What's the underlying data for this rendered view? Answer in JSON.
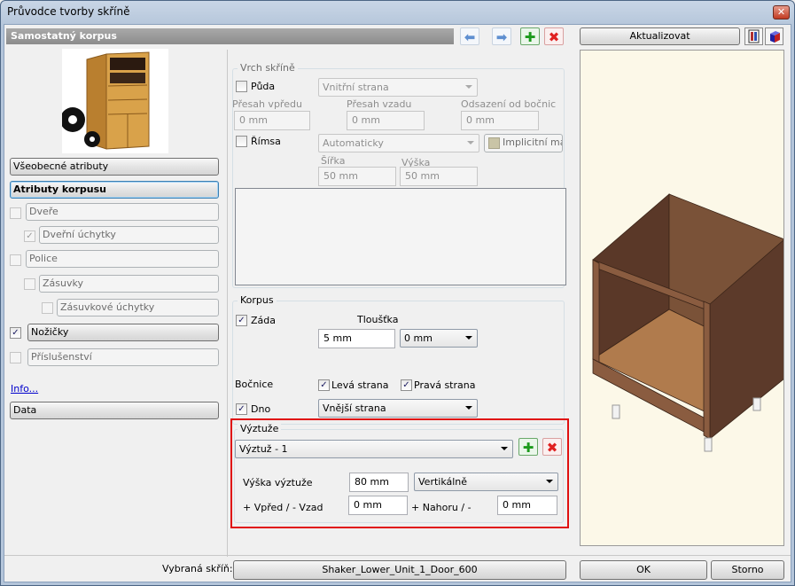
{
  "window": {
    "title": "Průvodce tvorby skříně",
    "close_glyph": "✕"
  },
  "header": {
    "title": "Samostatný korpus"
  },
  "toolbar": {
    "back_glyph": "⬅",
    "forward_glyph": "➡",
    "add_glyph": "✚",
    "remove_glyph": "✖"
  },
  "sidebar": {
    "general": "Všeobecné atributy",
    "carcass": "Atributy korpusu",
    "doors": "Dveře",
    "door_handles": "Dveřní úchytky",
    "shelves": "Police",
    "drawers": "Zásuvky",
    "drawer_handles": "Zásuvkové úchytky",
    "legs": "Nožičky",
    "accessories": "Příslušenství",
    "info_link": "Info...",
    "data": "Data"
  },
  "top": {
    "group_title": "Vrch skříně",
    "bottom_label": "Půda",
    "bottom_combo": "Vnitřní strana",
    "front_overhang_label": "Přesah vpředu",
    "front_overhang": "0 mm",
    "back_overhang_label": "Přesah vzadu",
    "back_overhang": "0 mm",
    "side_offset_label": "Odsazení od bočnic",
    "side_offset": "0 mm",
    "cornice_label": "Římsa",
    "cornice_combo": "Automaticky",
    "material_label": "Implicitní mate",
    "width_label": "Šířka",
    "width": "50 mm",
    "height_label": "Výška",
    "height": "50 mm"
  },
  "carcass": {
    "group_title": "Korpus",
    "back_label": "Záda",
    "thickness_label": "Tloušťka",
    "thickness": "5 mm",
    "thickness_combo": "0 mm",
    "sides_label": "Bočnice",
    "left_side": "Levá strana",
    "right_side": "Pravá strana",
    "bottom_label": "Dno",
    "bottom_combo": "Vnější strana"
  },
  "stiffeners": {
    "group_title": "Výztuže",
    "selected": "Výztuž - 1",
    "height_label": "Výška výztuže",
    "height": "80 mm",
    "orientation": "Vertikálně",
    "front_back_label": "+ Vpřed / - Vzad",
    "front_back": "0 mm",
    "up_down_label": "+ Nahoru / -",
    "up_down": "0 mm",
    "highlight_color": "#e01010"
  },
  "preview": {
    "update_button": "Aktualizovat"
  },
  "footer": {
    "selected_label": "Vybraná skříň:",
    "selected_value": "Shaker_Lower_Unit_1_Door_600",
    "ok": "OK",
    "cancel": "Storno"
  },
  "check_glyph": "✓"
}
